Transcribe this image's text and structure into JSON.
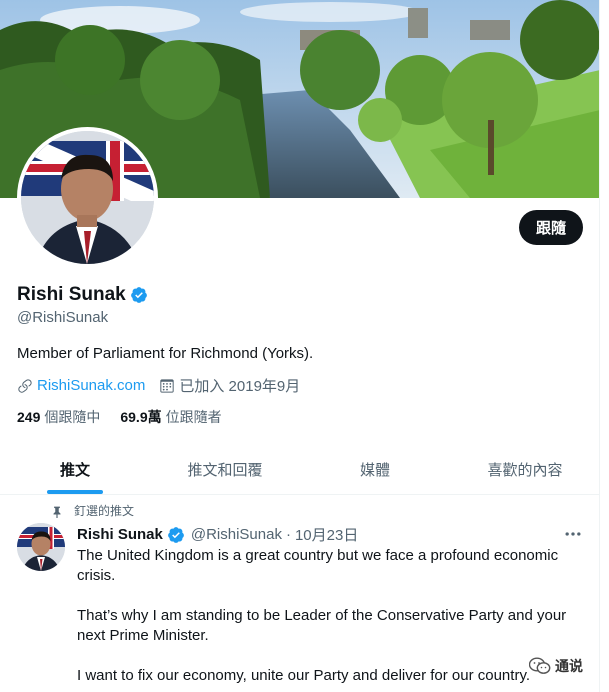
{
  "profile": {
    "display_name": "Rishi Sunak",
    "handle": "@RishiSunak",
    "bio": "Member of Parliament for Richmond (Yorks).",
    "website": "RishiSunak.com",
    "joined": "已加入 2019年9月",
    "following_count": "249",
    "following_label": "個跟隨中",
    "followers_count": "69.9萬",
    "followers_label": "位跟隨者",
    "follow_button": "跟隨",
    "verified": true
  },
  "tabs": [
    {
      "label": "推文",
      "active": true
    },
    {
      "label": "推文和回覆",
      "active": false
    },
    {
      "label": "媒體",
      "active": false
    },
    {
      "label": "喜歡的內容",
      "active": false
    }
  ],
  "pinned_tweet": {
    "pinned_label": "釘選的推文",
    "author_name": "Rishi Sunak",
    "author_handle": "@RishiSunak",
    "separator": "·",
    "date": "10月23日",
    "paragraphs": [
      "The United Kingdom is a great country but we face a profound economic crisis.",
      "That’s why I am standing to be Leader of the Conservative Party and your next Prime Minister.",
      "I want to fix our economy, unite our Party and deliver for our country."
    ]
  },
  "watermark": {
    "text": "通说"
  },
  "colors": {
    "accent": "#1d9bf0",
    "text_primary": "#0f1419",
    "text_secondary": "#536471",
    "button_bg": "#0f1419"
  },
  "icons": {
    "verified": "verified-badge-icon",
    "link": "link-icon",
    "calendar": "calendar-icon",
    "pin": "pin-icon",
    "more": "more-icon"
  }
}
